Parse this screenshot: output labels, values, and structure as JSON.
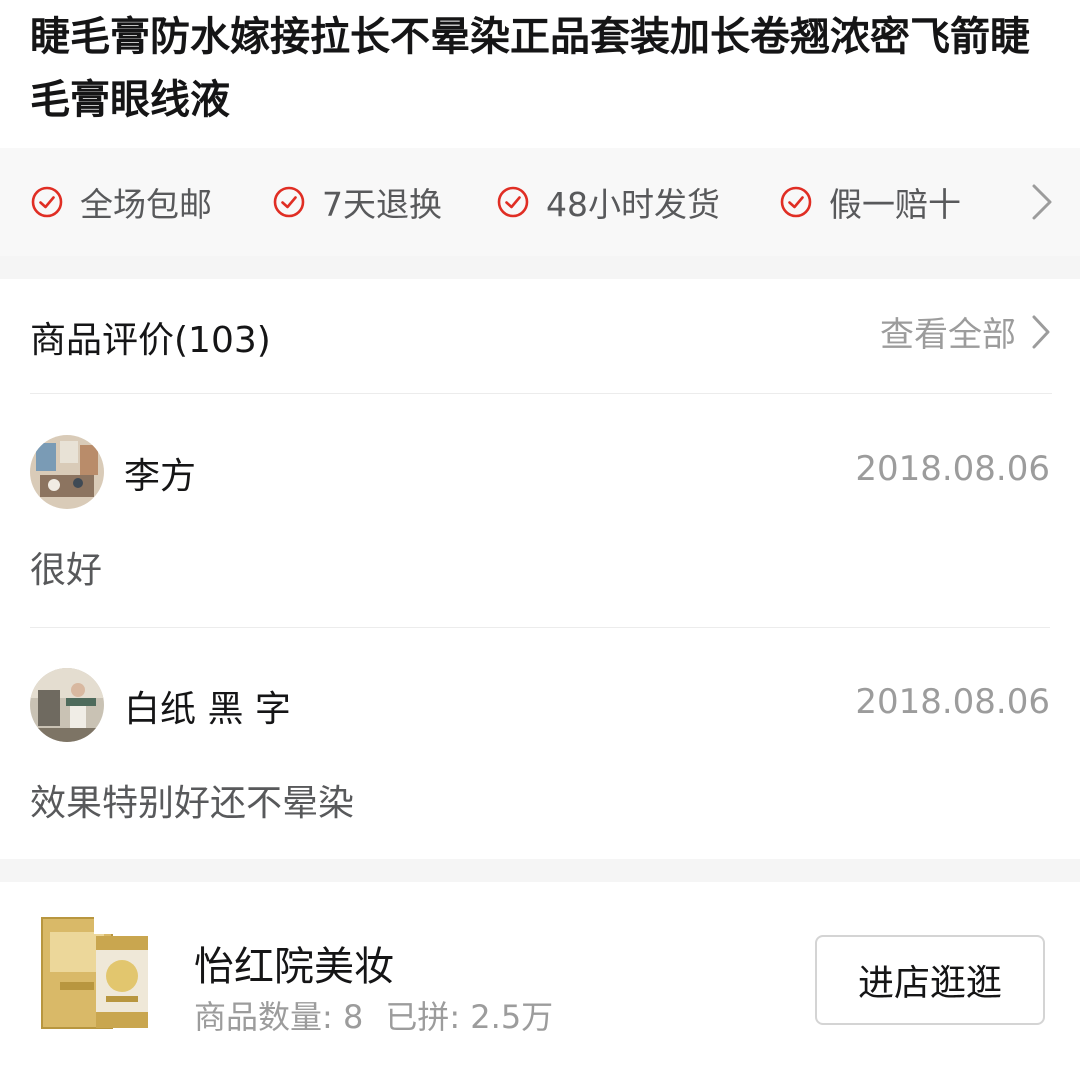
{
  "product": {
    "title": "睫毛膏防水嫁接拉长不晕染正品套装加长卷翘浓密飞箭睫毛膏眼线液"
  },
  "promises": {
    "items": [
      {
        "label": "全场包邮",
        "icon": "check-circle-icon"
      },
      {
        "label": "7天退换",
        "icon": "check-circle-icon"
      },
      {
        "label": "48小时发货",
        "icon": "check-circle-icon"
      },
      {
        "label": "假一赔十",
        "icon": "check-circle-icon"
      }
    ],
    "more_icon": "chevron-right-icon"
  },
  "reviews": {
    "heading": "商品评价(103)",
    "view_all": "查看全部",
    "items": [
      {
        "name": "李方",
        "date": "2018.08.06",
        "text": "很好",
        "avatar": "avatar-photo-icon"
      },
      {
        "name": "白纸 黑 字",
        "date": "2018.08.06",
        "text": "效果特别好还不晕染",
        "avatar": "avatar-photo-icon"
      }
    ]
  },
  "store": {
    "name": "怡红院美妆",
    "product_count": "商品数量: 8",
    "sold": "已拼: 2.5万",
    "enter_label": "进店逛逛",
    "thumbnail": "product-box-icon"
  },
  "colors": {
    "accent_red": "#e02e24",
    "muted_text": "#9c9c9c",
    "body_text": "#58595b",
    "divider_gray": "#f5f5f5"
  }
}
